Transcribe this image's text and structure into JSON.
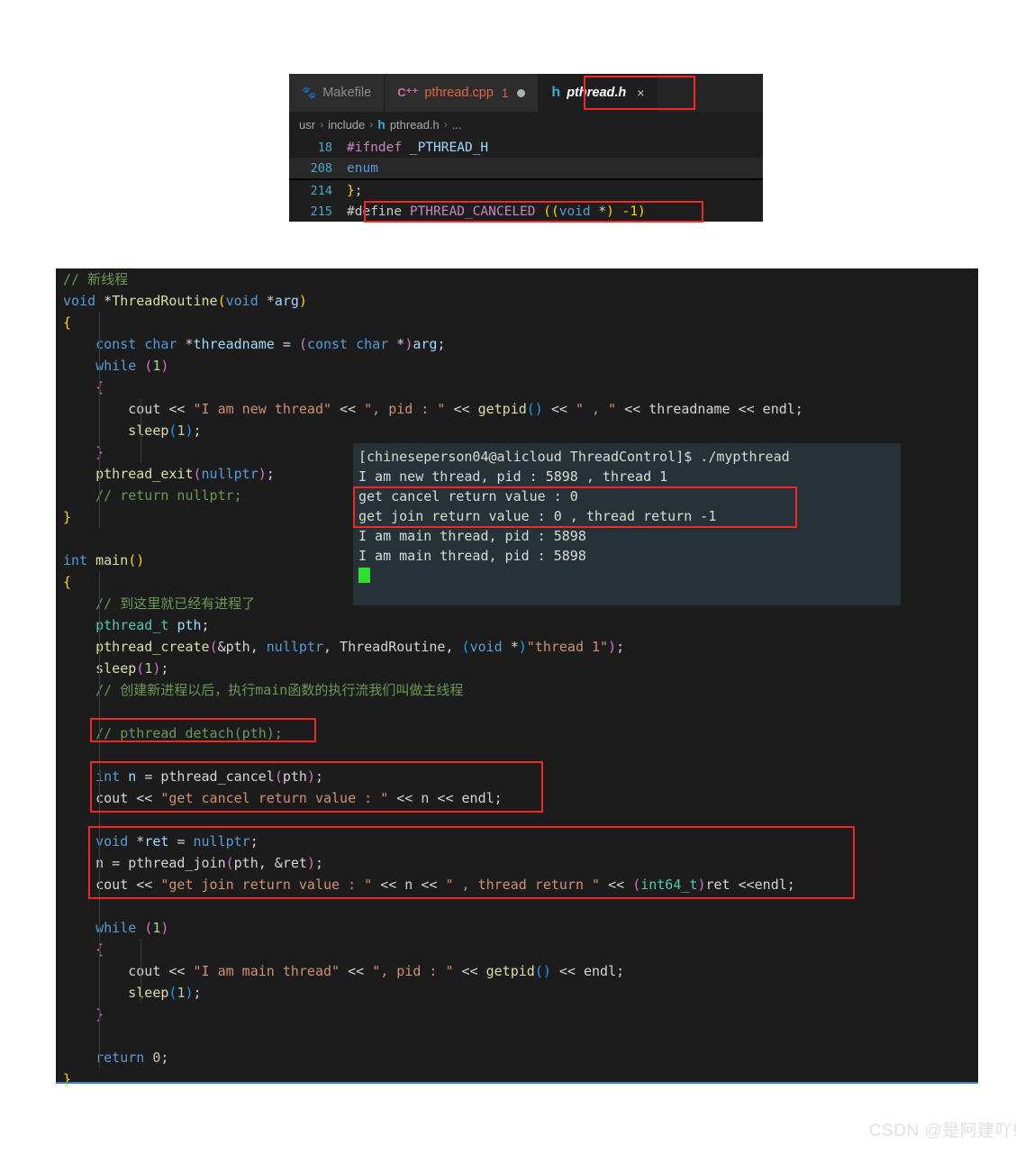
{
  "editor": {
    "tabs": [
      {
        "icon": "makefile-icon",
        "glyph": "🐾",
        "label": "Makefile",
        "badge": "",
        "dirty": false,
        "active": false,
        "italic": false
      },
      {
        "icon": "cpp-icon",
        "glyph": "C⁺⁺",
        "label": "pthread.cpp",
        "badge": "1",
        "dirty": true,
        "active": false,
        "italic": false
      },
      {
        "icon": "header-icon",
        "glyph": "h",
        "label": "pthread.h",
        "badge": "",
        "dirty": false,
        "active": true,
        "italic": true,
        "close": "×"
      }
    ],
    "breadcrumb": {
      "parts": [
        "usr",
        "include",
        "pthread.h",
        "..."
      ],
      "separator": "›",
      "file_icon": "h"
    },
    "lines": [
      {
        "num": "18",
        "code": "#ifndef _PTHREAD_H",
        "highlight": false
      },
      {
        "num": "208",
        "code": "enum",
        "highlight": true
      },
      {
        "num": "214",
        "code": "};",
        "highlight": false
      },
      {
        "num": "215",
        "code": "#define PTHREAD_CANCELED ((void *) -1)",
        "highlight": false
      }
    ]
  },
  "code": {
    "lines": [
      "// 新线程",
      "void *ThreadRoutine(void *arg)",
      "{",
      "    const char *threadname = (const char *)arg;",
      "    while (1)",
      "    {",
      "        cout << \"I am new thread\" << \", pid : \" << getpid() << \" , \" << threadname << endl;",
      "        sleep(1);",
      "    }",
      "    pthread_exit(nullptr);",
      "    // return nullptr;",
      "}",
      "",
      "int main()",
      "{",
      "    // 到这里就已经有进程了",
      "    pthread_t pth;",
      "    pthread_create(&pth, nullptr, ThreadRoutine, (void *)\"thread 1\");",
      "    sleep(1);",
      "    // 创建新进程以后，执行main函数的执行流我们叫做主线程",
      "",
      "    // pthread_detach(pth);",
      "",
      "    int n = pthread_cancel(pth);",
      "    cout << \"get cancel return value : \" << n << endl;",
      "",
      "    void *ret = nullptr;",
      "    n = pthread_join(pth, &ret);",
      "    cout << \"get join return value : \" << n << \" , thread return \" << (int64_t)ret <<endl;",
      "",
      "    while (1)",
      "    {",
      "        cout << \"I am main thread\" << \", pid : \" << getpid() << endl;",
      "        sleep(1);",
      "    }",
      "",
      "    return 0;",
      "}"
    ]
  },
  "terminal": {
    "prompt": "[chineseperson04@alicloud ThreadControl]$ ./mypthread",
    "lines": [
      "I am new thread, pid : 5898 , thread 1",
      "get cancel return value : 0",
      "get join return value : 0 , thread return -1",
      "I am main thread, pid : 5898",
      "I am main thread, pid : 5898"
    ]
  },
  "watermark": {
    "text": "CSDN @是阿建吖!"
  },
  "colors": {
    "accent_red": "#f42727",
    "editor_bg": "#1e1e1e",
    "code_bg": "#1c1c1c",
    "terminal_bg": "#263238",
    "cursor_green": "#2ee02e",
    "bottom_rule": "#3e7fbf"
  }
}
